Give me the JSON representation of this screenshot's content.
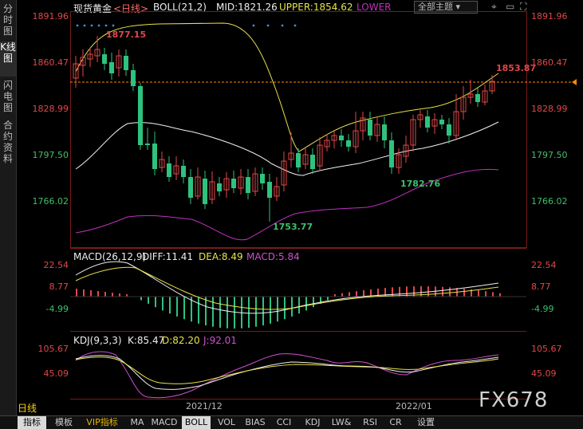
{
  "sidebar": {
    "tabs": [
      {
        "label": "分时图",
        "active": false
      },
      {
        "label": "K线图",
        "active": true
      },
      {
        "label": "闪电图",
        "active": false
      },
      {
        "label": "合约资料",
        "active": false
      }
    ]
  },
  "main": {
    "symbol": "现货黄金",
    "period": "<日线>",
    "boll": "BOLL(21,2)",
    "mid": "MID:1821.26",
    "upper": "UPPER:1854.62",
    "lower": "LOWER",
    "theme_select": "全部主题",
    "y_left": [
      "1891.96",
      "1860.47",
      "1828.99",
      "1797.50",
      "1766.02"
    ],
    "y_right": [
      "1891.96",
      "1860.47",
      "1828.99",
      "1797.50",
      "1766.02"
    ],
    "last_price": "1853.87",
    "ann_high": "1877.15",
    "ann_low1": "1753.77",
    "ann_low2": "1782.76"
  },
  "macd": {
    "title": "MACD(26,12,9)",
    "diff": "DIFF:11.41",
    "dea": "DEA:8.49",
    "macd": "MACD:5.84",
    "y": [
      "22.54",
      "8.77",
      "-4.99"
    ]
  },
  "kdj": {
    "title": "KDJ(9,3,3)",
    "k": "K:85.47",
    "d": "D:82.20",
    "j": "J:92.01",
    "y": [
      "105.67",
      "45.09"
    ]
  },
  "x_labels": [
    "2021/12",
    "2022/01"
  ],
  "period_label": "日线",
  "toolbar": [
    "指标",
    "模板",
    "VIP指标",
    "MA",
    "MACD",
    "BOLL",
    "VOL",
    "BIAS",
    "CCI",
    "KDJ",
    "LW&",
    "RSI",
    "CR",
    "设置"
  ],
  "watermark": "FX678",
  "colors": {
    "up": "#e04848",
    "down": "#2ec27e",
    "mid": "#f0f0f0",
    "upper": "#e8e24a",
    "lower": "#c030c0",
    "accent": "#ffd200"
  }
}
